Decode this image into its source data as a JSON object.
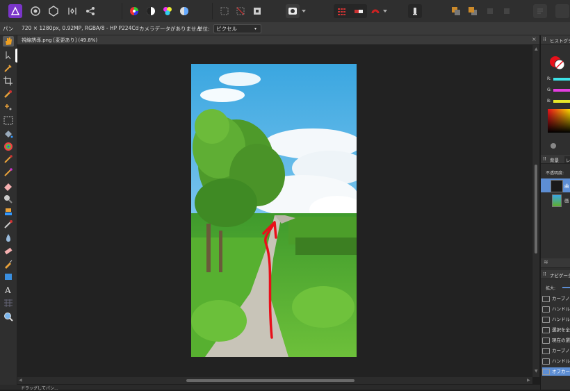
{
  "toolbar": {
    "icons": [
      "affinity-photo-logo",
      "photo-persona",
      "liquify-persona",
      "develop-persona",
      "tone-mapping-persona",
      "export-persona",
      "color-wheel",
      "contrast",
      "hsl",
      "white-balance",
      "marquee-selection",
      "no-selection",
      "invert-selection",
      "quick-mask",
      "grid",
      "snapping-toggle",
      "snapping-dropdown",
      "assistant",
      "arrange-back",
      "arrange-front",
      "arrange-forward",
      "arrange-backward",
      "more-options"
    ]
  },
  "context": {
    "tool_label": "パン",
    "doc_info": "720 × 1280px, 0.92MP, RGBA/8 - HP P224Cd",
    "camera_info": "カメラデータがありません",
    "units_label": "単位:",
    "units_value": "ピクセル"
  },
  "document": {
    "tab_title": "視線誘導.png [変更あり] (49.8%)"
  },
  "panels": {
    "histogram_title": "ヒストグラ",
    "color_labels": [
      "R:",
      "G:",
      "B:"
    ],
    "layers_tab1": "背景",
    "layers_tab2": "レ",
    "opacity_label": "不透明度:",
    "layer1_label": "曲",
    "layer2_label": "画",
    "navigator_title": "ナビゲータ",
    "zoom_label": "拡大:",
    "history": [
      {
        "label": "カーブノー",
        "selected": false
      },
      {
        "label": "ハンドル",
        "selected": false
      },
      {
        "label": "ハンドル",
        "selected": false
      },
      {
        "label": "選択を全",
        "selected": false
      },
      {
        "label": "現在の選",
        "selected": false
      },
      {
        "label": "カーブノー",
        "selected": false
      },
      {
        "label": "ハンドル",
        "selected": false
      },
      {
        "label": "オフカーブ",
        "selected": true
      }
    ]
  },
  "status": {
    "text": "ドラッグしてパン..."
  },
  "colors": {
    "accent": "#5d8ed4",
    "red_arrow": "#e8101a",
    "sky": "#56b4e6",
    "grass": "#5fae2e"
  }
}
